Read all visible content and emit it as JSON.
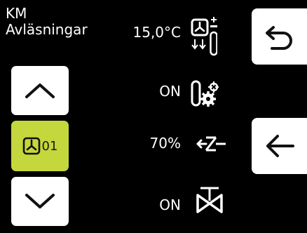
{
  "header": {
    "line1": "KM",
    "line2": "Avläsningar"
  },
  "readings": [
    {
      "value": "15,0°C",
      "icon": "fan-supply-temperature-icon"
    },
    {
      "value": "ON",
      "icon": "heating-gears-icon"
    },
    {
      "value": "70%",
      "icon": "damper-icon"
    },
    {
      "value": "ON",
      "icon": "valve-icon"
    }
  ],
  "unit": {
    "number": "01",
    "icon": "fan-icon"
  },
  "buttons": {
    "scroll_up": "chevron-up-icon",
    "scroll_down": "chevron-down-icon",
    "undo": "undo-arrow-icon",
    "back": "back-arrow-icon"
  },
  "colors": {
    "background": "#000000",
    "accent": "#c4d73c",
    "button": "#ffffff"
  }
}
